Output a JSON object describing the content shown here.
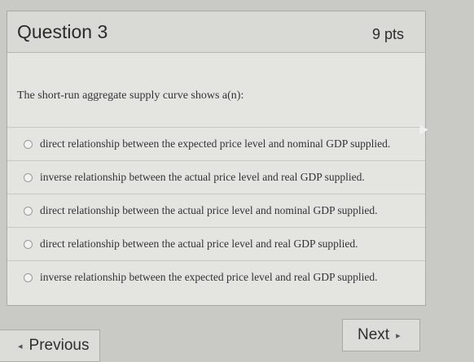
{
  "question": {
    "title": "Question 3",
    "points": "9 pts",
    "prompt": "The short-run aggregate supply curve shows a(n):",
    "answers": [
      {
        "label": "direct relationship between the expected price level and nominal GDP supplied."
      },
      {
        "label": "inverse relationship between the actual price level and real GDP supplied."
      },
      {
        "label": "direct relationship between the actual price level and nominal GDP supplied."
      },
      {
        "label": "direct relationship between the actual price level and real GDP supplied."
      },
      {
        "label": "inverse relationship between the expected price level and real GDP supplied."
      }
    ]
  },
  "nav": {
    "previous_label": "Previous",
    "next_label": "Next"
  },
  "icons": {
    "prev_arrow": "◂",
    "next_arrow": "▸"
  }
}
